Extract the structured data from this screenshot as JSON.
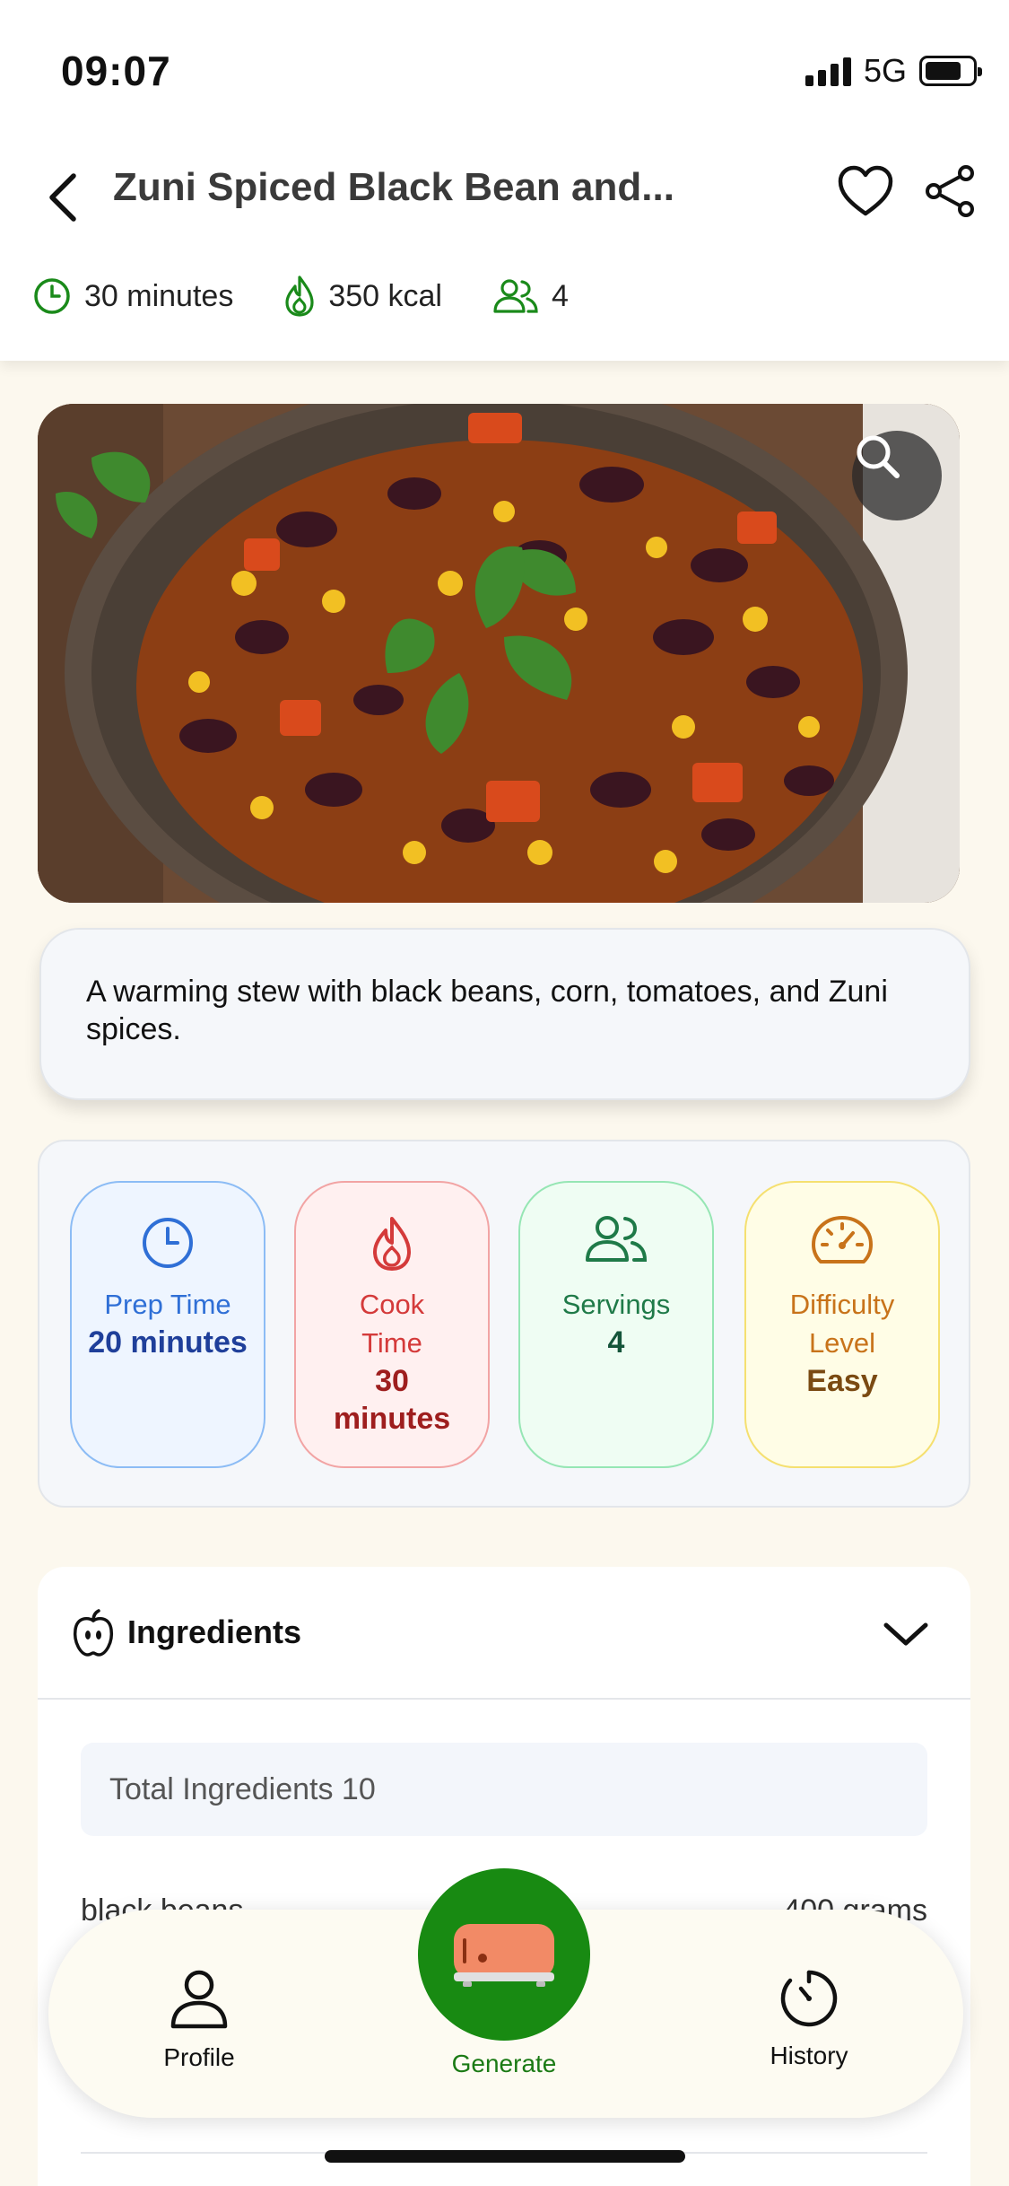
{
  "status_bar": {
    "time": "09:07",
    "network": "5G"
  },
  "header": {
    "title": "Zuni Spiced Black Bean and...",
    "meta": {
      "time": "30 minutes",
      "calories": "350 kcal",
      "servings": "4"
    }
  },
  "description": "A warming stew with black beans, corn, tomatoes, and Zuni spices.",
  "stats": {
    "prep": {
      "label": "Prep Time",
      "value": "20 minutes"
    },
    "cook": {
      "label": "Cook Time",
      "value": "30 minutes"
    },
    "servings": {
      "label": "Servings",
      "value": "4"
    },
    "difficulty": {
      "label": "Difficulty Level",
      "value": "Easy"
    }
  },
  "ingredients": {
    "title": "Ingredients",
    "total_label": "Total Ingredients 10",
    "items": [
      {
        "name": "black beans",
        "amount": "400 grams"
      }
    ]
  },
  "nav": {
    "profile": "Profile",
    "generate": "Generate",
    "history": "History"
  },
  "colors": {
    "accent_green": "#188a12",
    "header_icon_green": "#1a8a1a",
    "prep_blue": "#2f6fd6",
    "cook_red": "#d43a3a",
    "servings_green": "#1f7a48",
    "difficulty_orange": "#c8731a"
  }
}
